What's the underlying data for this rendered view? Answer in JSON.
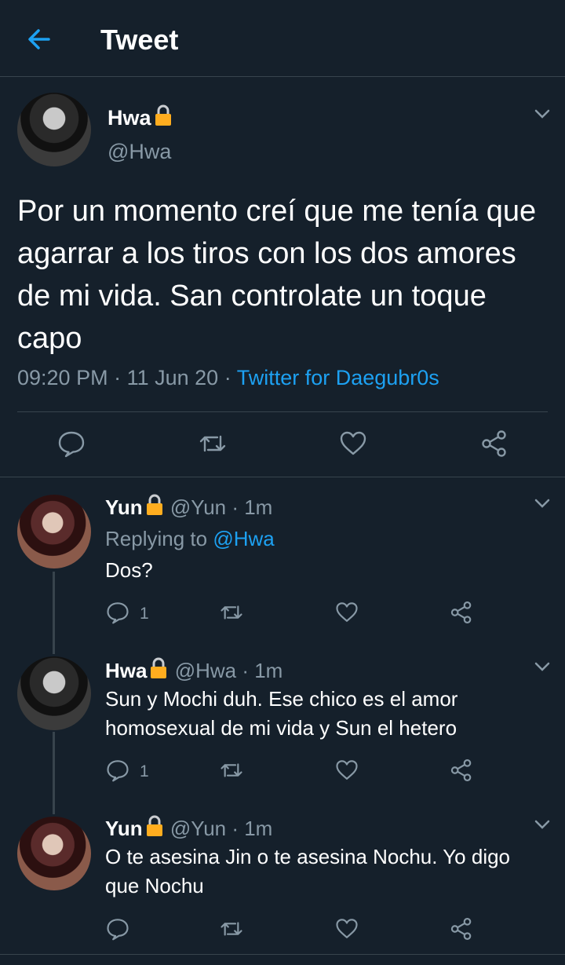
{
  "header": {
    "title": "Tweet"
  },
  "main_tweet": {
    "name": "Hwa",
    "handle": "@Hwa",
    "text": "Por un momento creí que me tenía que agarrar a los tiros con los dos amores de mi vida. San controlate un toque capo",
    "time": "09:20 PM",
    "date": "11 Jun 20",
    "sep1": " · ",
    "sep2": " · ",
    "source": "Twitter for Daegubr0s"
  },
  "replies": [
    {
      "name": "Yun",
      "handle_time": " @Yun · 1m",
      "replying_prefix": "Replying to ",
      "replying_handle": "@Hwa",
      "text": "Dos?",
      "reply_count": "1"
    },
    {
      "name": "Hwa",
      "handle_time": " @Hwa · 1m",
      "text": "Sun y Mochi duh. Ese chico es el amor homosexual de mi vida y Sun el hetero",
      "reply_count": "1"
    },
    {
      "name": "Yun",
      "handle_time": " @Yun · 1m",
      "text": "O te asesina Jin o te asesina Nochu. Yo digo que Nochu",
      "reply_count": ""
    }
  ],
  "colors": {
    "background": "#15202b",
    "accent": "#1da1f2",
    "secondary": "#8899a6",
    "border": "#38444d",
    "lock": "#ffad1f"
  },
  "icons": [
    "back-arrow-icon",
    "lock-icon",
    "chevron-down-icon",
    "reply-icon",
    "retweet-icon",
    "like-icon",
    "share-icon"
  ]
}
